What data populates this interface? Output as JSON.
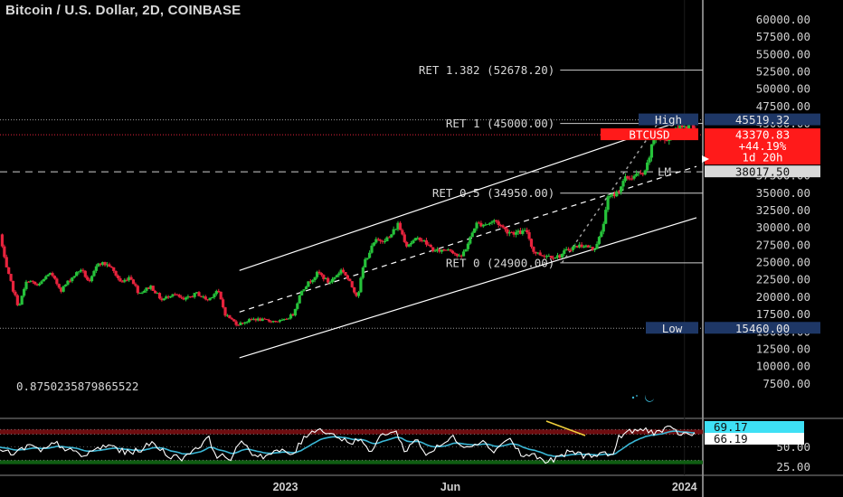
{
  "header": {
    "title": "Bitcoin / U.S. Dollar, 2D, COINBASE"
  },
  "colors": {
    "up": "#26c23a",
    "down": "#e8233d",
    "rsi": "#ffffff",
    "rsi_ma": "#3ab7d6",
    "high_tag": "#1e3766",
    "low_tag": "#1e3766",
    "price_tag": "#ff1a1a",
    "lm_tag": "#d9d9d9",
    "channel": "#ffffff",
    "trend_high": "#f3d23c"
  },
  "chart_data": [
    {
      "type": "candlestick",
      "title": "Bitcoin / U.S. Dollar, 2D, COINBASE",
      "y_ticks": [
        "60000.00",
        "57500.00",
        "55000.00",
        "52500.00",
        "50000.00",
        "47500.00",
        "45000.00",
        "42500.00",
        "40000.00",
        "37500.00",
        "35000.00",
        "32500.00",
        "30000.00",
        "27500.00",
        "25000.00",
        "22500.00",
        "20000.00",
        "17500.00",
        "15000.00",
        "12500.00",
        "10000.00",
        "7500.00"
      ],
      "ylim": [
        6500,
        61500
      ],
      "x_ticks": [
        "2023",
        "Jun",
        "2024"
      ],
      "x_tick_dates": [
        "2023-01-01",
        "2023-06-01",
        "2024-01-01"
      ],
      "xlim": [
        "2022-04-15",
        "2024-05-25"
      ],
      "anchors": [
        [
          "2022-04-17",
          29000
        ],
        [
          "2022-04-22",
          24500
        ],
        [
          "2022-04-28",
          21500
        ],
        [
          "2022-05-04",
          18500
        ],
        [
          "2022-05-12",
          22500
        ],
        [
          "2022-05-22",
          21500
        ],
        [
          "2022-06-01",
          23500
        ],
        [
          "2022-06-12",
          21000
        ],
        [
          "2022-06-20",
          22500
        ],
        [
          "2022-06-30",
          24000
        ],
        [
          "2022-07-08",
          22000
        ],
        [
          "2022-07-16",
          25000
        ],
        [
          "2022-07-26",
          24500
        ],
        [
          "2022-08-06",
          22000
        ],
        [
          "2022-08-14",
          23000
        ],
        [
          "2022-08-22",
          20500
        ],
        [
          "2022-09-02",
          21500
        ],
        [
          "2022-09-12",
          19500
        ],
        [
          "2022-09-22",
          20500
        ],
        [
          "2022-10-02",
          19500
        ],
        [
          "2022-10-14",
          20500
        ],
        [
          "2022-10-24",
          19500
        ],
        [
          "2022-11-02",
          21000
        ],
        [
          "2022-11-09",
          17500
        ],
        [
          "2022-11-20",
          16000
        ],
        [
          "2022-12-05",
          16800
        ],
        [
          "2022-12-20",
          16500
        ],
        [
          "2023-01-01",
          16500
        ],
        [
          "2023-01-10",
          17500
        ],
        [
          "2023-01-18",
          21000
        ],
        [
          "2023-02-02",
          23500
        ],
        [
          "2023-02-12",
          22000
        ],
        [
          "2023-02-24",
          24000
        ],
        [
          "2023-03-10",
          20000
        ],
        [
          "2023-03-16",
          25000
        ],
        [
          "2023-03-26",
          28000
        ],
        [
          "2023-04-08",
          28500
        ],
        [
          "2023-04-16",
          30500
        ],
        [
          "2023-04-24",
          27500
        ],
        [
          "2023-05-06",
          28500
        ],
        [
          "2023-05-20",
          26500
        ],
        [
          "2023-06-02",
          27000
        ],
        [
          "2023-06-12",
          25500
        ],
        [
          "2023-06-20",
          28000
        ],
        [
          "2023-06-26",
          30500
        ],
        [
          "2023-07-06",
          30500
        ],
        [
          "2023-07-14",
          31000
        ],
        [
          "2023-07-24",
          29500
        ],
        [
          "2023-08-02",
          29200
        ],
        [
          "2023-08-12",
          29400
        ],
        [
          "2023-08-18",
          26500
        ],
        [
          "2023-08-26",
          26000
        ],
        [
          "2023-09-10",
          25800
        ],
        [
          "2023-09-20",
          27000
        ],
        [
          "2023-10-02",
          27500
        ],
        [
          "2023-10-12",
          26800
        ],
        [
          "2023-10-20",
          29500
        ],
        [
          "2023-10-24",
          34000
        ],
        [
          "2023-11-02",
          35000
        ],
        [
          "2023-11-10",
          37000
        ],
        [
          "2023-11-20",
          37500
        ],
        [
          "2023-11-28",
          37800
        ],
        [
          "2023-12-04",
          41500
        ],
        [
          "2023-12-08",
          44000
        ],
        [
          "2023-12-14",
          42500
        ],
        [
          "2023-12-24",
          43500
        ],
        [
          "2024-01-02",
          45000
        ],
        [
          "2024-01-06",
          44000
        ],
        [
          "2024-01-10",
          46000
        ],
        [
          "2024-01-12",
          43370.83
        ]
      ],
      "lines": {
        "high": {
          "label": "High",
          "value": "45519.32",
          "level": 45519.32
        },
        "low": {
          "label": "Low",
          "value": "15460.00",
          "level": 15460
        },
        "lm": {
          "label": "LM",
          "value": "38017.50",
          "level": 38017.5
        },
        "price": {
          "label": "BTCUSD",
          "value": "43370.83",
          "change": "+44.19%",
          "countdown": "1d 20h",
          "level": 43370.83
        }
      },
      "fib_levels": [
        {
          "label": "RET 1.382 (52678.20)",
          "level": 52678.2
        },
        {
          "label": "RET 1 (45000.00)",
          "level": 45000
        },
        {
          "label": "RET 0.5 (34950.00)",
          "level": 34950
        },
        {
          "label": "RET 0 (24900.00)",
          "level": 24900
        }
      ],
      "fib_start": "2023-09-11",
      "annotation": "0.8750235879865522",
      "channel": {
        "upper": [
          [
            "2022-11-20",
            23800
          ],
          [
            "2024-01-12",
            46100
          ]
        ],
        "middle": [
          [
            "2022-11-20",
            17800
          ],
          [
            "2024-01-12",
            38800
          ]
        ],
        "lower": [
          [
            "2022-11-20",
            11200
          ],
          [
            "2024-01-12",
            31400
          ]
        ]
      },
      "trend_high": [
        [
          "2023-12-08",
          45100
        ],
        [
          "2024-01-12",
          45600
        ]
      ],
      "projection": [
        [
          "2023-09-11",
          24900
        ],
        [
          "2023-12-08",
          45100
        ]
      ]
    },
    {
      "type": "line",
      "title": "RSI",
      "y_ticks": [
        "50.00",
        "25.00"
      ],
      "ylim": [
        15,
        85
      ],
      "bands": {
        "upper": [
          66,
          72
        ],
        "lower": [
          28,
          33
        ]
      },
      "series": [
        {
          "value": "69.17"
        },
        {
          "value": "66.19"
        }
      ],
      "rsi_anchors": [
        [
          0,
          45
        ],
        [
          0.02,
          40
        ],
        [
          0.04,
          52
        ],
        [
          0.06,
          44
        ],
        [
          0.08,
          55
        ],
        [
          0.1,
          45
        ],
        [
          0.12,
          38
        ],
        [
          0.14,
          48
        ],
        [
          0.16,
          52
        ],
        [
          0.18,
          42
        ],
        [
          0.2,
          46
        ],
        [
          0.22,
          55
        ],
        [
          0.24,
          40
        ],
        [
          0.26,
          35
        ],
        [
          0.28,
          48
        ],
        [
          0.3,
          60
        ],
        [
          0.31,
          40
        ],
        [
          0.33,
          35
        ],
        [
          0.35,
          58
        ],
        [
          0.36,
          42
        ],
        [
          0.38,
          38
        ],
        [
          0.4,
          45
        ],
        [
          0.42,
          40
        ],
        [
          0.44,
          65
        ],
        [
          0.45,
          72
        ],
        [
          0.47,
          70
        ],
        [
          0.49,
          60
        ],
        [
          0.5,
          56
        ],
        [
          0.52,
          60
        ],
        [
          0.53,
          40
        ],
        [
          0.55,
          68
        ],
        [
          0.57,
          68
        ],
        [
          0.58,
          45
        ],
        [
          0.6,
          60
        ],
        [
          0.61,
          40
        ],
        [
          0.63,
          50
        ],
        [
          0.65,
          62
        ],
        [
          0.67,
          50
        ],
        [
          0.69,
          58
        ],
        [
          0.71,
          45
        ],
        [
          0.73,
          62
        ],
        [
          0.75,
          38
        ],
        [
          0.77,
          40
        ],
        [
          0.78,
          30
        ],
        [
          0.8,
          35
        ],
        [
          0.82,
          45
        ],
        [
          0.84,
          38
        ],
        [
          0.86,
          42
        ],
        [
          0.88,
          40
        ],
        [
          0.89,
          65
        ],
        [
          0.91,
          70
        ],
        [
          0.93,
          72
        ],
        [
          0.94,
          68
        ],
        [
          0.96,
          73
        ],
        [
          0.98,
          66
        ],
        [
          1,
          66
        ]
      ]
    }
  ]
}
